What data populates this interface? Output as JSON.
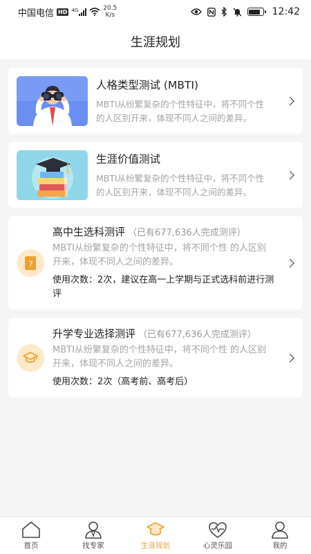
{
  "status_bar": {
    "carrier": "中国电信",
    "hd": "HD",
    "net_type": "4G",
    "net_speed_value": "20.5",
    "net_speed_unit": "K/s",
    "time": "12:42",
    "battery_level": 0.85
  },
  "header": {
    "title": "生涯规划"
  },
  "cards": [
    {
      "title": "人格类型测试 (MBTI)",
      "desc": "MBTI从纷繁复杂的个性特征中，将不同个性 的人区别开来，体现不同人之间的差异。"
    },
    {
      "title": "生涯价值测试",
      "desc": "MBTI从纷繁复杂的个性特征中，将不同个性 的人区别开来，体现不同人之间的差异。"
    }
  ],
  "evaluations": [
    {
      "title": "高中生选科测评",
      "count": "（已有677,636人完成测评）",
      "desc": "MBTI从纷繁复杂的个性特征中，将不同个性 的人区别开来，体现不同人之间的差异。",
      "usage": "使用次数：2次，建议在高一上学期与正式选科前进行测评",
      "icon": "question-book-icon"
    },
    {
      "title": "升学专业选择测评",
      "count": "（已有677,636人完成测评）",
      "desc": "MBTI从纷繁复杂的个性特征中，将不同个性 的人区别开来，体现不同人之间的差异。",
      "usage": "使用次数：2次（高考前、高考后）",
      "icon": "graduation-cap-icon"
    }
  ],
  "nav": [
    {
      "label": "首页",
      "icon": "home-icon"
    },
    {
      "label": "找专家",
      "icon": "expert-icon"
    },
    {
      "label": "生涯规划",
      "icon": "graduation-cap-icon",
      "active": true
    },
    {
      "label": "心灵乐园",
      "icon": "heart-pulse-icon"
    },
    {
      "label": "我的",
      "icon": "user-icon"
    }
  ],
  "colors": {
    "accent": "#e8a33c",
    "icon_bg": "#fde9c9",
    "page_bg": "#f5f5f5"
  }
}
